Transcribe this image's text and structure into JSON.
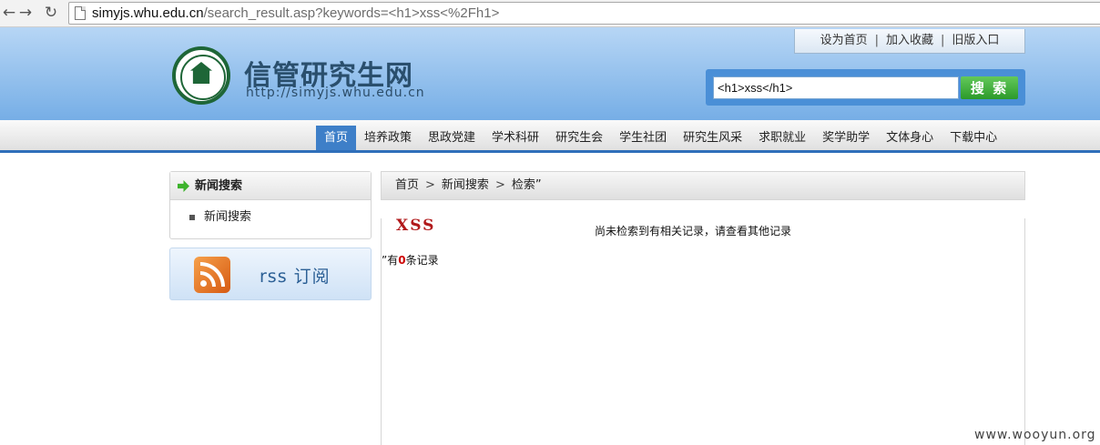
{
  "browser": {
    "back_icon": "←",
    "forward_icon": "→",
    "reload_icon": "↻",
    "url_host": "simyjs.whu.edu.cn",
    "url_path": "/search_result.asp?keywords=<h1>xss<%2Fh1>"
  },
  "header": {
    "site_title": "信管研究生网",
    "site_url": "http://simyjs.whu.edu.cn",
    "toplinks": [
      {
        "label": "设为首页"
      },
      {
        "label": "加入收藏"
      },
      {
        "label": "旧版入口"
      }
    ],
    "separator": "|",
    "search": {
      "value": "<h1>xss</h1>",
      "button_label": "搜 索"
    }
  },
  "nav": {
    "items": [
      {
        "label": "首页",
        "active": true
      },
      {
        "label": "培养政策"
      },
      {
        "label": "思政党建"
      },
      {
        "label": "学术科研"
      },
      {
        "label": "研究生会"
      },
      {
        "label": "学生社团"
      },
      {
        "label": "研究生风采"
      },
      {
        "label": "求职就业"
      },
      {
        "label": "奖学助学"
      },
      {
        "label": "文体身心"
      },
      {
        "label": "下载中心"
      }
    ]
  },
  "sidebar": {
    "title": "新闻搜索",
    "items": [
      {
        "label": "新闻搜索"
      }
    ],
    "rss_label": "rss 订阅"
  },
  "breadcrumb": {
    "items": [
      "首页",
      "新闻搜索",
      "检索”"
    ],
    "separator": ">"
  },
  "main": {
    "xss_title": "XSS",
    "no_result": "尚未检索到有相关记录，请查看其他记录",
    "count_prefix": "”有",
    "count_value": "0",
    "count_suffix": "条记录"
  },
  "watermark": "www.wooyun.org",
  "colors": {
    "header_blue": "#76aee6",
    "nav_active": "#3e7fc8",
    "search_button": "#2c9a2a",
    "xss_red": "#b1191b"
  }
}
